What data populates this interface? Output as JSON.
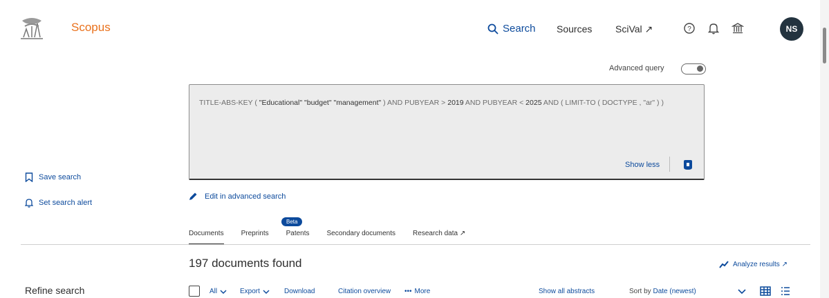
{
  "header": {
    "brand": "Scopus",
    "nav": {
      "search": "Search",
      "sources": "Sources",
      "scival": "SciVal ↗"
    },
    "avatar_initials": "NS"
  },
  "advanced_query": {
    "label": "Advanced query"
  },
  "query": {
    "text_pre": "TITLE-ABS-KEY ( ",
    "terms": "\"Educational\" \"budget\" \"management\"",
    "text_mid1": " ) AND PUBYEAR > ",
    "year_from": "2019",
    "text_mid2": " AND PUBYEAR < ",
    "year_to": "2025",
    "text_post": " AND ( LIMIT-TO ( DOCTYPE , \"ar\" ) )",
    "show_less": "Show less"
  },
  "sidebar": {
    "save_search": "Save search",
    "set_alert": "Set search alert",
    "refine": "Refine search"
  },
  "edit_advanced": "Edit in advanced search",
  "tabs": [
    {
      "label": "Documents"
    },
    {
      "label": "Preprints"
    },
    {
      "label": "Patents"
    },
    {
      "label": "Secondary documents"
    },
    {
      "label": "Research data ↗"
    }
  ],
  "beta_badge": "Beta",
  "results": {
    "count_text": "197 documents found",
    "analyze": "Analyze results ↗"
  },
  "toolbar": {
    "all": "All",
    "export": "Export",
    "download": "Download",
    "citation_overview": "Citation overview",
    "more": "More",
    "show_abstracts": "Show all abstracts",
    "sort_by_label": "Sort by",
    "sort_by_value": "Date (newest)"
  },
  "colors": {
    "brand": "#e9711c",
    "link": "#0c4a9c",
    "avatar_bg": "#23333f"
  }
}
